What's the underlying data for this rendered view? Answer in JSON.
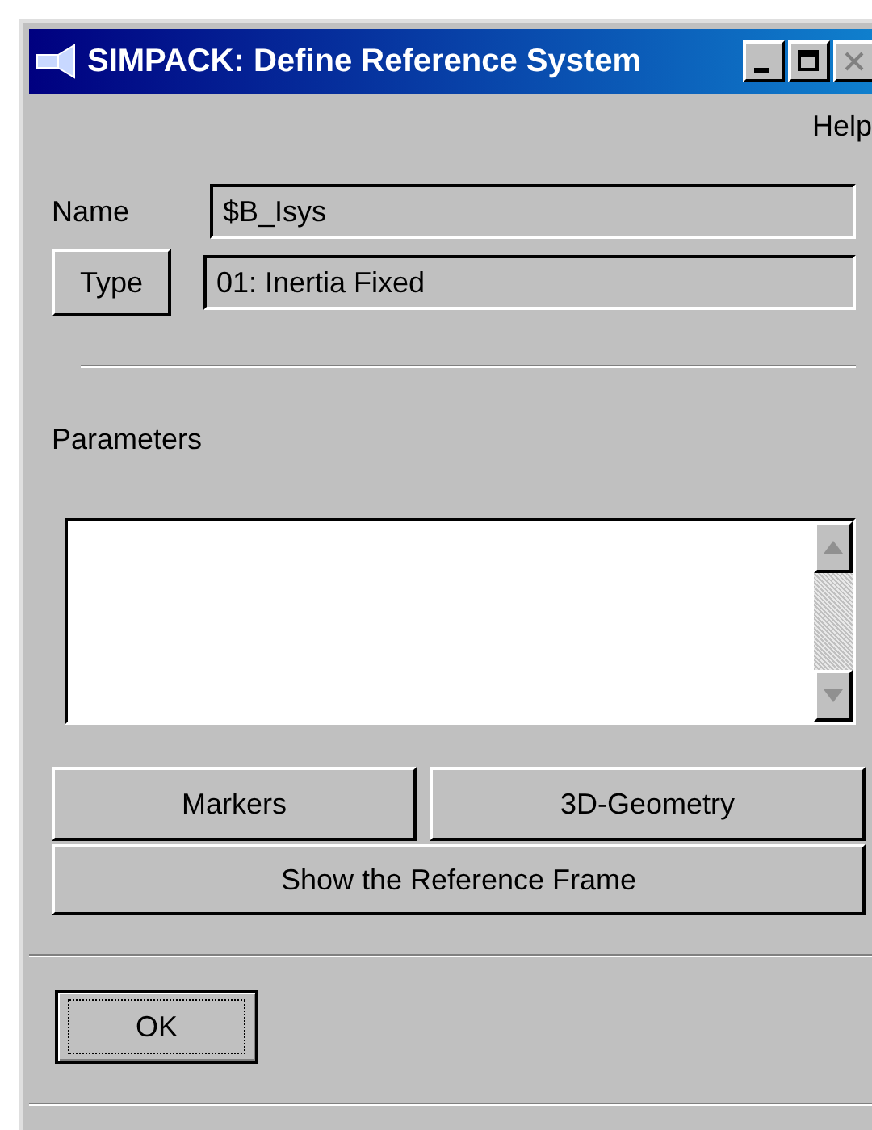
{
  "window": {
    "title": "SIMPACK: Define Reference System"
  },
  "menu": [
    {
      "label": "Help"
    }
  ],
  "name_field": {
    "label": "Name",
    "value": "$B_Isys"
  },
  "type_field": {
    "button": "Type",
    "value": "01: Inertia Fixed"
  },
  "parameters": {
    "label": "Parameters"
  },
  "action_buttons": [
    {
      "label": "Markers"
    },
    {
      "label": "3D-Geometry"
    }
  ],
  "frame_button": {
    "label": "Show the Reference Frame"
  },
  "ok_button": {
    "label": "OK",
    "focused": true
  }
}
